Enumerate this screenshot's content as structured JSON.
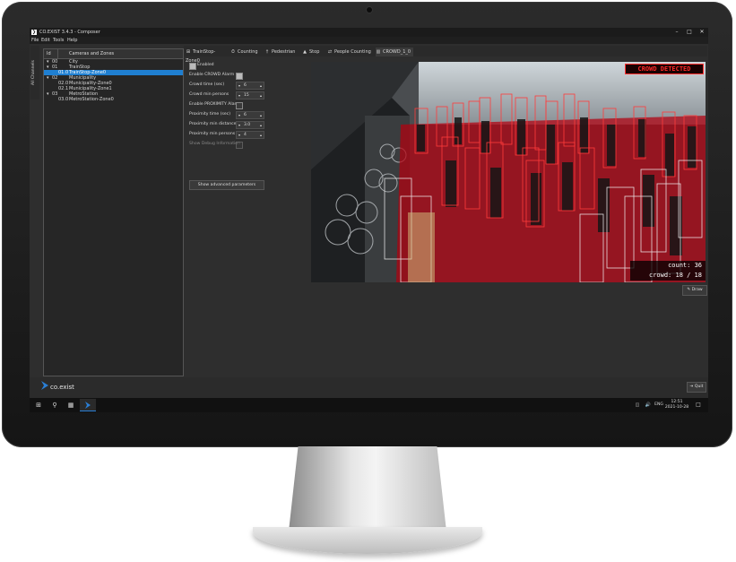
{
  "window": {
    "title": "CO.EXIST 3.4.3 - Composer",
    "app_icon": "co-exist-app-icon"
  },
  "menu": [
    "File",
    "Edit",
    "Tools",
    "Help"
  ],
  "side_tab_label": "All Channels",
  "tree": {
    "col_id": "Id",
    "col_name": "Cameras and Zones",
    "rows": [
      {
        "toggle": "▾",
        "id": "00",
        "name": "City",
        "selected": false
      },
      {
        "toggle": "▾",
        "id": "01",
        "name": "TrainStop",
        "selected": false
      },
      {
        "toggle": "",
        "id": "01.0",
        "name": "TrainStop-Zone0",
        "selected": true
      },
      {
        "toggle": "▾",
        "id": "02",
        "name": "Municipality",
        "selected": false
      },
      {
        "toggle": "",
        "id": "02.0",
        "name": "Municipality-Zone0",
        "selected": false
      },
      {
        "toggle": "",
        "id": "02.1",
        "name": "Municipality-Zone1",
        "selected": false
      },
      {
        "toggle": "▾",
        "id": "03",
        "name": "MetroStation",
        "selected": false
      },
      {
        "toggle": "",
        "id": "03.0",
        "name": "MetroStation-Zone0",
        "selected": false
      }
    ]
  },
  "tabs": [
    {
      "icon": "grid-icon",
      "glyph": "⊞",
      "label": "TrainStop-Zone0"
    },
    {
      "icon": "stopwatch-icon",
      "glyph": "⏱",
      "label": "Counting"
    },
    {
      "icon": "pedestrian-icon",
      "glyph": "†",
      "label": "Pedestrian"
    },
    {
      "icon": "warning-icon",
      "glyph": "▲",
      "label": "Stop"
    },
    {
      "icon": "people-counting-icon",
      "glyph": "⇄",
      "label": "People Counting"
    },
    {
      "icon": "crowd-icon",
      "glyph": "▥",
      "label": "CROWD_1_0"
    }
  ],
  "settings": {
    "enabled_label": "Enabled",
    "enable_crowd_alarm_label": "Enable CROWD Alarm",
    "crowd_time_label": "Crowd time  (sec)",
    "crowd_time_value": "6",
    "crowd_min_persons_label": "Crowd min persons",
    "crowd_min_persons_value": "15",
    "enable_proximity_label": "Enable PROXIMITY Alarm",
    "proximity_time_label": "Proximity time  (sec)",
    "proximity_time_value": "6",
    "proximity_min_distance_label": "Proximity min distance  (m)",
    "proximity_min_distance_value": "3.0",
    "proximity_min_persons_label": "Proximity min persons",
    "proximity_min_persons_value": "4",
    "show_debug_label": "Show Debug Information",
    "advanced_button": "Show advanced parameters"
  },
  "video": {
    "alert": "CROWD DETECTED",
    "count_line": "count: 36",
    "crowd_line": "crowd: 18 / 18"
  },
  "buttons": {
    "draw": "Draw",
    "save": "Save",
    "apply": "Apply",
    "discard": "Discard",
    "quit": "Quit"
  },
  "footer": {
    "logo_text": "co.exist"
  },
  "taskbar": {
    "lang": "ENG",
    "time": "12:51",
    "date": "2021-10-28"
  },
  "colors": {
    "selection": "#1f7fd1",
    "alert_red": "#ff2a2a",
    "overlay_red": "#b3000f",
    "screen_bg": "#2e2e2e"
  }
}
